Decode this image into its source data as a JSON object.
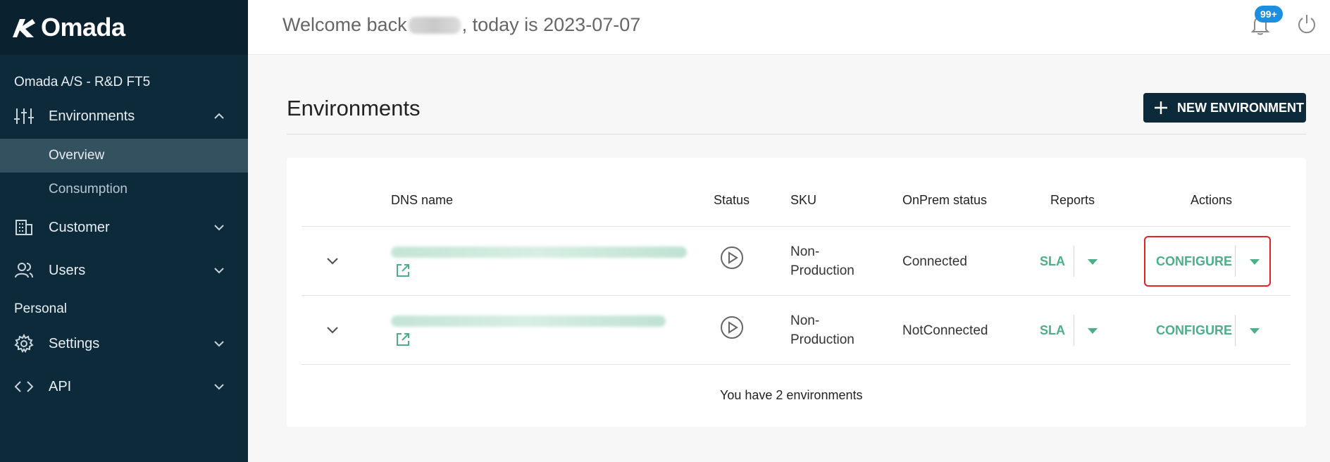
{
  "app": {
    "logo_text": "Omada"
  },
  "sidebar": {
    "org_name": "Omada A/S - R&D FT5",
    "environments_label": "Environments",
    "sub_items": [
      {
        "label": "Overview",
        "active": true
      },
      {
        "label": "Consumption",
        "active": false
      }
    ],
    "customer_label": "Customer",
    "users_label": "Users",
    "personal_section": "Personal",
    "settings_label": "Settings",
    "api_label": "API"
  },
  "header": {
    "welcome_prefix": "Welcome back",
    "welcome_suffix": ", today is 2023-07-07",
    "notification_badge": "99+"
  },
  "main": {
    "title": "Environments",
    "new_button_label": "NEW ENVIRONMENT",
    "columns": [
      "DNS name",
      "Status",
      "SKU",
      "OnPrem status",
      "Reports",
      "Actions"
    ],
    "rows": [
      {
        "sku_line1": "Non-",
        "sku_line2": "Production",
        "onprem_status": "Connected",
        "report_label": "SLA",
        "action_label": "CONFIGURE"
      },
      {
        "sku_line1": "Non-",
        "sku_line2": "Production",
        "onprem_status": "NotConnected",
        "report_label": "SLA",
        "action_label": "CONFIGURE"
      }
    ],
    "footer": "You have 2 environments"
  },
  "colors": {
    "sidebar": "#0d2a3b",
    "accent_green": "#4caf8a",
    "badge_blue": "#1d8fe1",
    "highlight_red": "#e0242a"
  }
}
